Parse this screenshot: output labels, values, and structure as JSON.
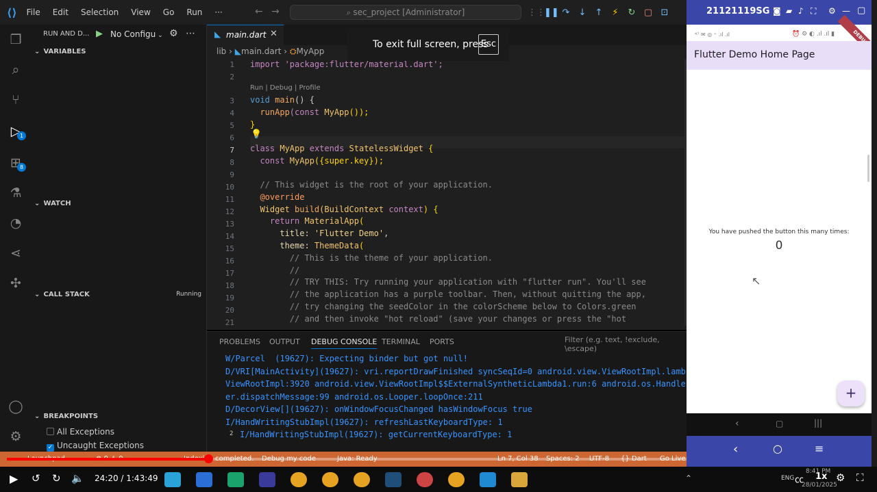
{
  "titlebar": {
    "menu": [
      "File",
      "Edit",
      "Selection",
      "View",
      "Go",
      "Run",
      "···"
    ],
    "search": "sec_project [Administrator]"
  },
  "sidebar": {
    "run_label": "RUN AND D...",
    "config": "No Configu",
    "variables": "VARIABLES",
    "watch": "WATCH",
    "call_stack": "CALL STACK",
    "call_stack_status": "Running",
    "breakpoints": "BREAKPOINTS",
    "bp_all": "All Exceptions",
    "bp_uncaught": "Uncaught Exceptions"
  },
  "editor": {
    "tab": "main.dart",
    "breadcrumb": [
      "lib",
      "main.dart",
      "MyApp"
    ],
    "codelens": "Run | Debug | Profile",
    "lines": [
      "1",
      "2",
      "3",
      "4",
      "5",
      "6",
      "7",
      "8",
      "9",
      "10",
      "11",
      "12",
      "13",
      "14",
      "15",
      "16",
      "17",
      "18",
      "19",
      "20",
      "21"
    ],
    "code": {
      "l1": "import 'package:flutter/material.dart';",
      "l3a": "void ",
      "l3b": "main",
      "l3c": "() {",
      "l4a": "  runApp",
      "l4b": "(const ",
      "l4c": "MyApp",
      "l4d": "());",
      "l5": "}",
      "l7a": "class ",
      "l7b": "MyApp ",
      "l7c": "extends ",
      "l7d": "StatelessWidget ",
      "l7e": "{",
      "l8a": "  const ",
      "l8b": "MyApp",
      "l8c": "({super.key});",
      "l10": "  // This widget is the root of your application.",
      "l11": "  @override",
      "l12a": "  Widget ",
      "l12b": "build",
      "l12c": "(BuildContext ",
      "l12d": "context",
      "l12e": ") {",
      "l13a": "    return ",
      "l13b": "MaterialApp",
      "l13c": "(",
      "l14a": "      title: ",
      "l14b": "'Flutter Demo'",
      "l14c": ",",
      "l15a": "      theme: ",
      "l15b": "ThemeData",
      "l15c": "(",
      "l16": "        // This is the theme of your application.",
      "l17": "        //",
      "l18": "        // TRY THIS: Try running your application with \"flutter run\". You'll see",
      "l19": "        // the application has a purple toolbar. Then, without quitting the app,",
      "l20": "        // try changing the seedColor in the colorScheme below to Colors.green",
      "l21": "        // and then invoke \"hot reload\" (save your changes or press the \"hot"
    }
  },
  "panel": {
    "tabs": [
      "PROBLEMS",
      "OUTPUT",
      "DEBUG CONSOLE",
      "TERMINAL",
      "PORTS"
    ],
    "filter_placeholder": "Filter (e.g. text, !exclude, \\escape)",
    "lines": [
      "W/Parcel  (19627): Expecting binder but got null!",
      "D/VRI[MainActivity](19627): vri.reportDrawFinished syncSeqId=0 android.view.ViewRootImpl.lamb",
      "ViewRootImpl:3920 android.view.ViewRootImpl$$ExternalSyntheticLambda1.run:6 android.os.Handle",
      "er.dispatchMessage:99 android.os.Looper.loopOnce:211",
      "D/DecorView[](19627): onWindowFocusChanged hasWindowFocus true",
      "I/HandWritingStubImpl(19627): refreshLastKeyboardType: 1",
      "I/HandWritingStubImpl(19627): getCurrentKeyboardType: 1"
    ],
    "repeat_count": "2"
  },
  "statusbar": {
    "items": [
      "Launchpad",
      "⊗ 0 ⚠ 0",
      "Indexing completed.",
      "Debug my code",
      "Java: Ready",
      "Ln 7, Col 38",
      "Spaces: 2",
      "UTF-8",
      "{} Dart",
      "Go Live"
    ]
  },
  "video": {
    "time": "24:20 / 1:43:49",
    "speed": "1x",
    "progress_fraction": 0.234
  },
  "taskbar": {
    "clock_time": "8:41 PM",
    "clock_date": "28/01/2025",
    "lang": "ENG"
  },
  "phone": {
    "device": "21121119SG",
    "status": "⁴⁷ ✉ ◎ ⁺ .ıl .ıl",
    "app_title": "Flutter Demo Home Page",
    "debug_banner": "DEBUG",
    "message": "You have pushed the button this many times:",
    "counter": "0",
    "fab": "+"
  },
  "toast": {
    "text": "To exit full screen, press",
    "key": "Esc"
  }
}
